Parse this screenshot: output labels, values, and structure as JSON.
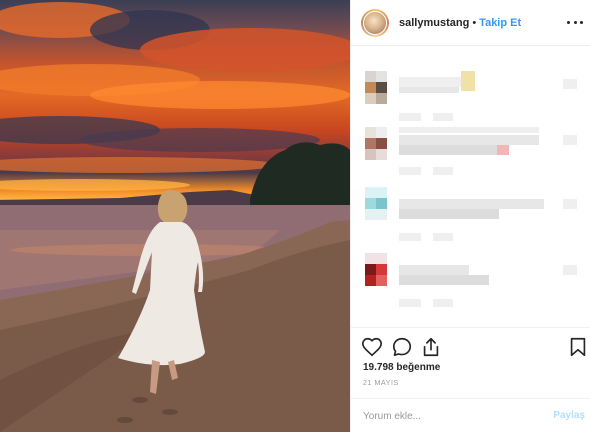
{
  "post": {
    "photo_description_icon": "sunset-beach-photo"
  },
  "header": {
    "username": "sallymustang",
    "separator": "•",
    "follow_label": "Takip Et",
    "more_icon": "more-horizontal-icon"
  },
  "actions": {
    "like_icon": "heart-icon",
    "comment_icon": "comment-bubble-icon",
    "share_icon": "share-upload-icon",
    "save_icon": "bookmark-icon"
  },
  "likes": {
    "count_label": "19.798 beğenme"
  },
  "date": {
    "label": "21 MAYIS"
  },
  "comment_box": {
    "placeholder": "Yorum ekle...",
    "submit_label": "Paylaş"
  },
  "colors": {
    "link_blue": "#3897f0",
    "share_disabled": "#b2dffc",
    "border": "#efefef"
  }
}
